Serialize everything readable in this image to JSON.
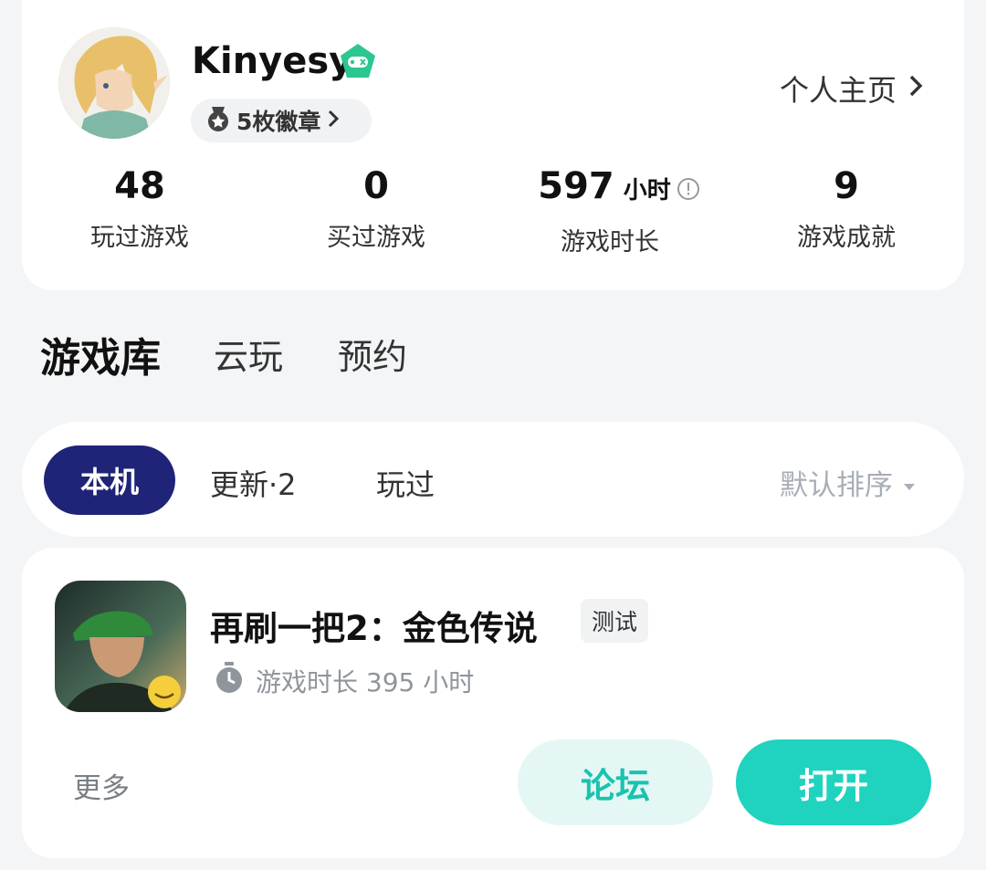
{
  "profile": {
    "username": "Kinyesy",
    "badges_label": "5枚徽章",
    "home_link": "个人主页"
  },
  "stats": [
    {
      "value": "48",
      "unit": "",
      "label": "玩过游戏"
    },
    {
      "value": "0",
      "unit": "",
      "label": "买过游戏"
    },
    {
      "value": "597",
      "unit": "小时",
      "label": "游戏时长"
    },
    {
      "value": "9",
      "unit": "",
      "label": "游戏成就"
    }
  ],
  "tabs": [
    "游戏库",
    "云玩",
    "预约"
  ],
  "filters": {
    "local": "本机",
    "update": "更新·2",
    "played": "玩过",
    "sort": "默认排序"
  },
  "game": {
    "title": "再刷一把2：金色传说",
    "badge": "测试",
    "playtime": "游戏时长 395 小时",
    "more": "更多",
    "forum": "论坛",
    "open": "打开"
  },
  "colors": {
    "accent": "#1fd3bf",
    "accent_light": "#e4f7f5",
    "active_filter": "#1f2478",
    "vip_green": "#2cc78f"
  }
}
